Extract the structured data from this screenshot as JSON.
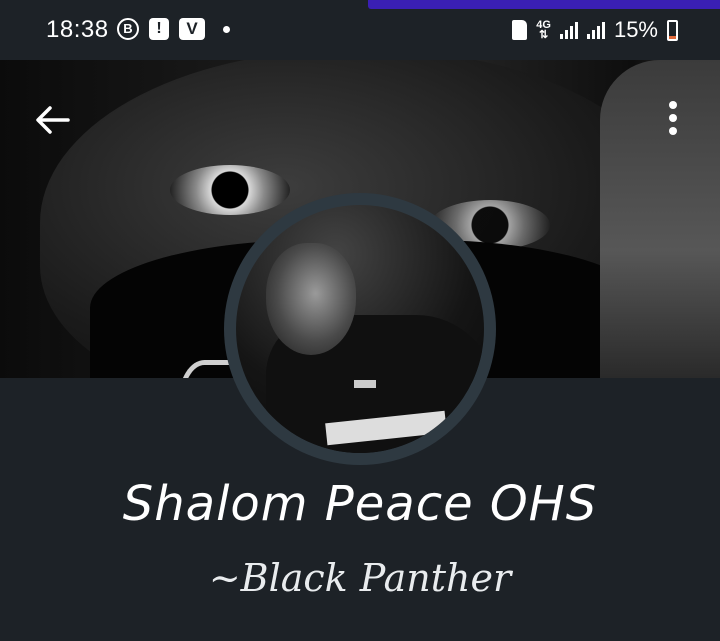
{
  "status_bar": {
    "time": "18:38",
    "notification_icons": [
      "b-circle-icon",
      "alert-icon",
      "v-app-icon",
      "dot-icon"
    ],
    "b_label": "B",
    "alert_label": "!",
    "v_label": "V",
    "network_label": "4G",
    "battery_percent": "15%",
    "battery_level": 0.15,
    "battery_low_color": "#e06a3b",
    "progress_color": "#3a1fb4"
  },
  "header": {
    "back_icon": "arrow-left-icon",
    "menu_icon": "more-vertical-icon"
  },
  "profile": {
    "name": "Shalom Peace OHS",
    "about": "~Black Panther"
  },
  "colors": {
    "background": "#1d2227",
    "avatar_ring": "#2e3941",
    "text": "#ffffff"
  }
}
